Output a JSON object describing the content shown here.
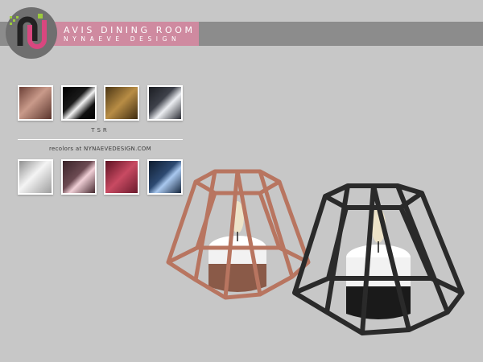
{
  "header": {
    "title": "AVIS DINING ROOM",
    "subtitle": "NYNAEVE DESIGN",
    "bar_color": "#8c8c8c",
    "panel_color": "#cf8aa0"
  },
  "logo": {
    "icon": "nd-logo-icon",
    "colors": [
      "#9ccc3c",
      "#d9477f",
      "#222222"
    ]
  },
  "swatches": {
    "tsr": [
      {
        "name": "copper",
        "color": "#7a4a3f"
      },
      {
        "name": "black",
        "color": "#111111"
      },
      {
        "name": "gold",
        "color": "#8a6a2c"
      },
      {
        "name": "gunmetal",
        "color": "#3c3f47"
      }
    ],
    "tsr_label": "TSR",
    "recolors_label": "recolors at NYNAEVEDESIGN.COM",
    "recolors": [
      {
        "name": "silver",
        "color": "#b4b4b4"
      },
      {
        "name": "dusty-rose",
        "color": "#5a3a40"
      },
      {
        "name": "raspberry",
        "color": "#9b2b42"
      },
      {
        "name": "navy",
        "color": "#1f3550"
      }
    ]
  },
  "products": [
    {
      "name": "copper-geometric-candle-holder",
      "frame_color": "#b87560"
    },
    {
      "name": "black-geometric-candle-holder",
      "frame_color": "#2a2a2a"
    }
  ]
}
